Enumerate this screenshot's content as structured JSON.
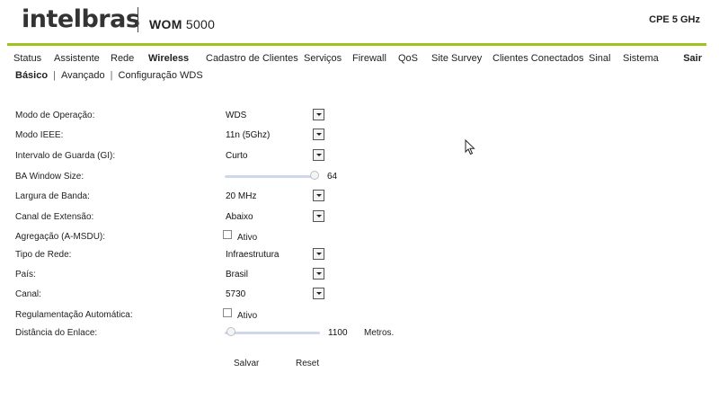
{
  "header": {
    "logo": "intelbras",
    "model_prefix": "WOM",
    "model_number": " 5000",
    "device_type": "CPE 5 GHz",
    "accent_color": "#9dc31c"
  },
  "nav": {
    "items": [
      {
        "label": "Status"
      },
      {
        "label": "Assistente"
      },
      {
        "label": "Rede"
      },
      {
        "label": "Wireless"
      },
      {
        "label": "Cadastro de Clientes"
      },
      {
        "label": "Serviços"
      },
      {
        "label": "Firewall"
      },
      {
        "label": "QoS"
      },
      {
        "label": "Site Survey"
      },
      {
        "label": "Clientes Conectados"
      },
      {
        "label": "Sinal"
      },
      {
        "label": "Sistema"
      }
    ],
    "active": "Wireless",
    "logout": "Sair"
  },
  "subnav": {
    "items": [
      {
        "label": "Básico"
      },
      {
        "label": "Avançado"
      },
      {
        "label": "Configuração WDS"
      }
    ],
    "separator": "|",
    "active": "Básico"
  },
  "form": {
    "mode": {
      "label": "Modo de Operação:",
      "value": "WDS"
    },
    "ieee": {
      "label": "Modo IEEE:",
      "value": "11n (5Ghz)"
    },
    "gi": {
      "label": "Intervalo de Guarda (GI):",
      "value": "Curto"
    },
    "ba_window": {
      "label": "BA Window Size:",
      "value": "64",
      "level": 1.0
    },
    "bandwidth": {
      "label": "Largura de Banda:",
      "value": "20 MHz"
    },
    "ext_channel": {
      "label": "Canal de Extensão:",
      "value": "Abaixo"
    },
    "aggregation": {
      "label": "Agregação (A-MSDU):",
      "checkbox_label": "Ativo",
      "checked": false
    },
    "network_type": {
      "label": "Tipo de Rede:",
      "value": "Infraestrutura"
    },
    "country": {
      "label": "País:",
      "value": "Brasil"
    },
    "channel": {
      "label": "Canal:",
      "value": "5730"
    },
    "auto_reg": {
      "label": "Regulamentação Automática:",
      "checkbox_label": "Ativo",
      "checked": false
    },
    "distance": {
      "label": "Distância do Enlace:",
      "value": "1100",
      "unit": "Metros.",
      "level": 0.0
    }
  },
  "actions": {
    "save": "Salvar",
    "reset": "Reset"
  }
}
